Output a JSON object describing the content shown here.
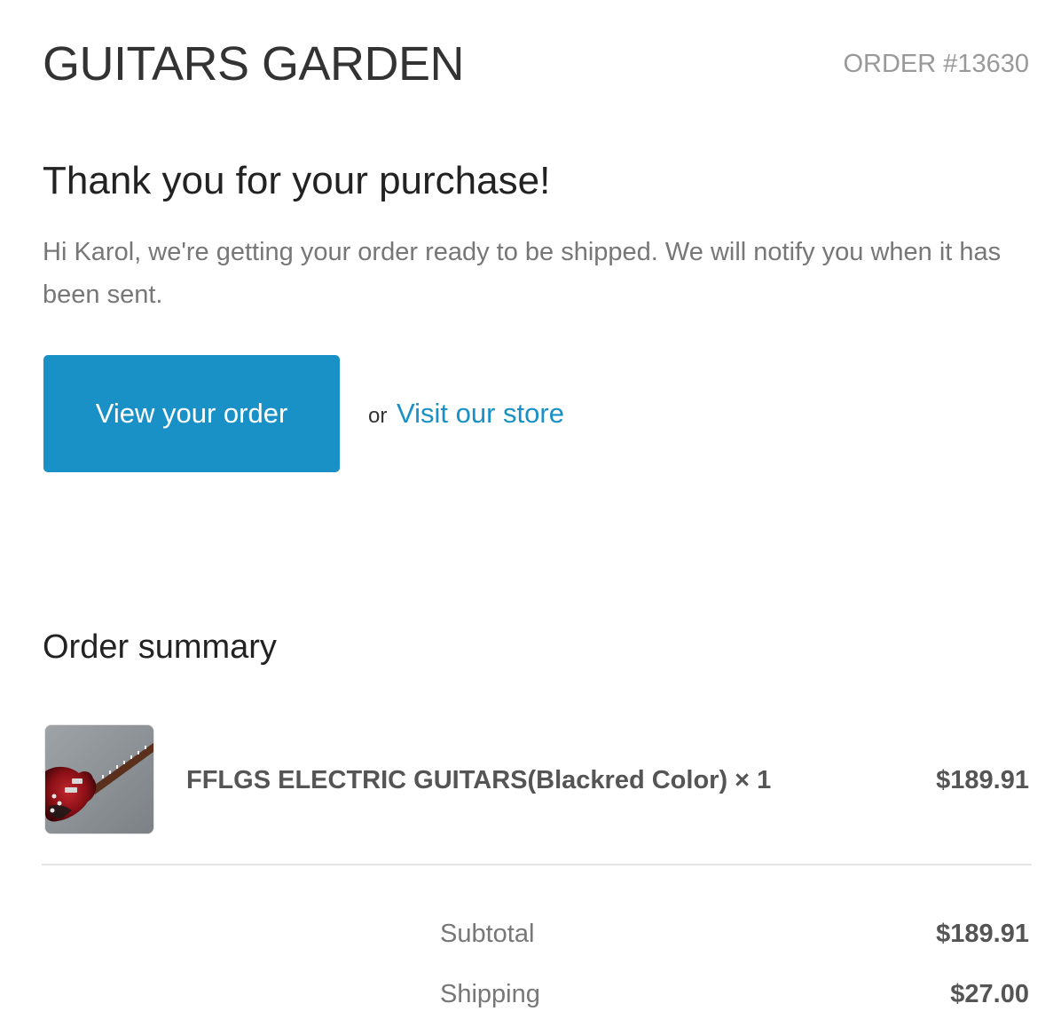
{
  "header": {
    "shop_name": "GUITARS GARDEN",
    "order_number": "ORDER #13630"
  },
  "confirmation": {
    "title": "Thank you for your purchase!",
    "message": "Hi Karol, we're getting your order ready to be shipped. We will notify you when it has been sent.",
    "button_label": "View your order",
    "or_text": "or",
    "store_link_label": "Visit our store"
  },
  "summary": {
    "title": "Order summary",
    "items": [
      {
        "image": "guitar-product-image",
        "title": "FFLGS ELECTRIC GUITARS(Blackred Color) × 1",
        "price": "$189.91"
      }
    ],
    "totals": [
      {
        "label": "Subtotal",
        "value": "$189.91"
      },
      {
        "label": "Shipping",
        "value": "$27.00"
      }
    ]
  },
  "colors": {
    "accent": "#1990c6",
    "text_dark": "#333333",
    "text_muted": "#777777",
    "order_number": "#999999",
    "divider": "#e5e5e5"
  }
}
